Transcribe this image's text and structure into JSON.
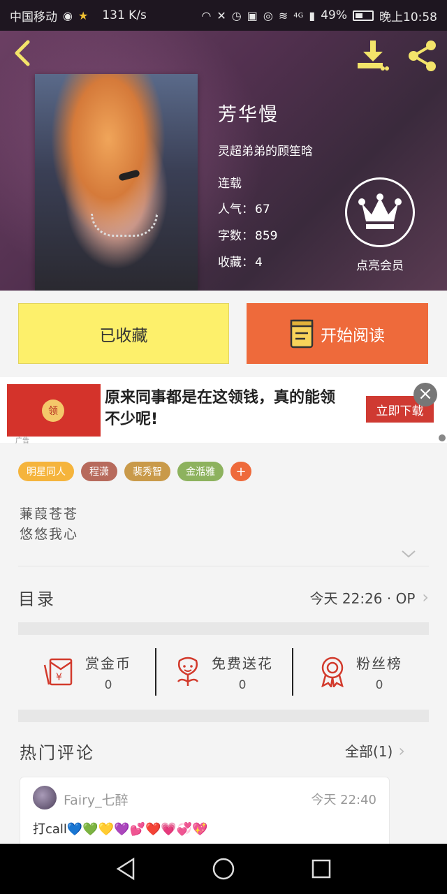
{
  "statusbar": {
    "carrier": "中国移动",
    "speed": "131 K/s",
    "network": "4G",
    "battery": "49%",
    "time": "晚上10:58"
  },
  "book": {
    "title": "芳华慢",
    "author": "灵超弟弟的顾笙晗",
    "status": "连载",
    "popularity_label": "人气：",
    "popularity": "67",
    "words_label": "字数：",
    "words": "859",
    "favorites_label": "收藏：",
    "favorites": "4"
  },
  "vip": {
    "label": "点亮会员"
  },
  "actions": {
    "favorited_label": "已收藏",
    "read_label": "开始阅读"
  },
  "ad": {
    "text": "原来同事都是在这领钱，真的能领不少呢!",
    "coin_text": "领",
    "tag": "广告",
    "cta": "立即下载"
  },
  "tags": [
    {
      "label": "明星同人",
      "color": "#f5b43c"
    },
    {
      "label": "程潇",
      "color": "#b76a5c"
    },
    {
      "label": "裴秀智",
      "color": "#c99a4a"
    },
    {
      "label": "金湉雅",
      "color": "#8db25e"
    }
  ],
  "description": {
    "line1": "蒹葭苍苍",
    "line2": "悠悠我心"
  },
  "toc": {
    "title": "目录",
    "updated": "今天 22:26 · OP"
  },
  "stats": [
    {
      "label": "赏金币",
      "value": "0",
      "icon": "coin-envelope-icon"
    },
    {
      "label": "免费送花",
      "value": "0",
      "icon": "flower-icon"
    },
    {
      "label": "粉丝榜",
      "value": "0",
      "icon": "medal-icon"
    }
  ],
  "comments_section": {
    "title": "热门评论",
    "all_label": "全部(1)"
  },
  "comment": {
    "user": "Fairy_七醉",
    "time": "今天 22:40",
    "body": "打call💙💚💛💜💕❤️💗💞💖"
  },
  "colors": {
    "accent_yellow": "#fdf06b",
    "accent_orange": "#ee6a3b",
    "icon_yellow": "#f3e46a",
    "icon_red": "#d23a2c"
  }
}
